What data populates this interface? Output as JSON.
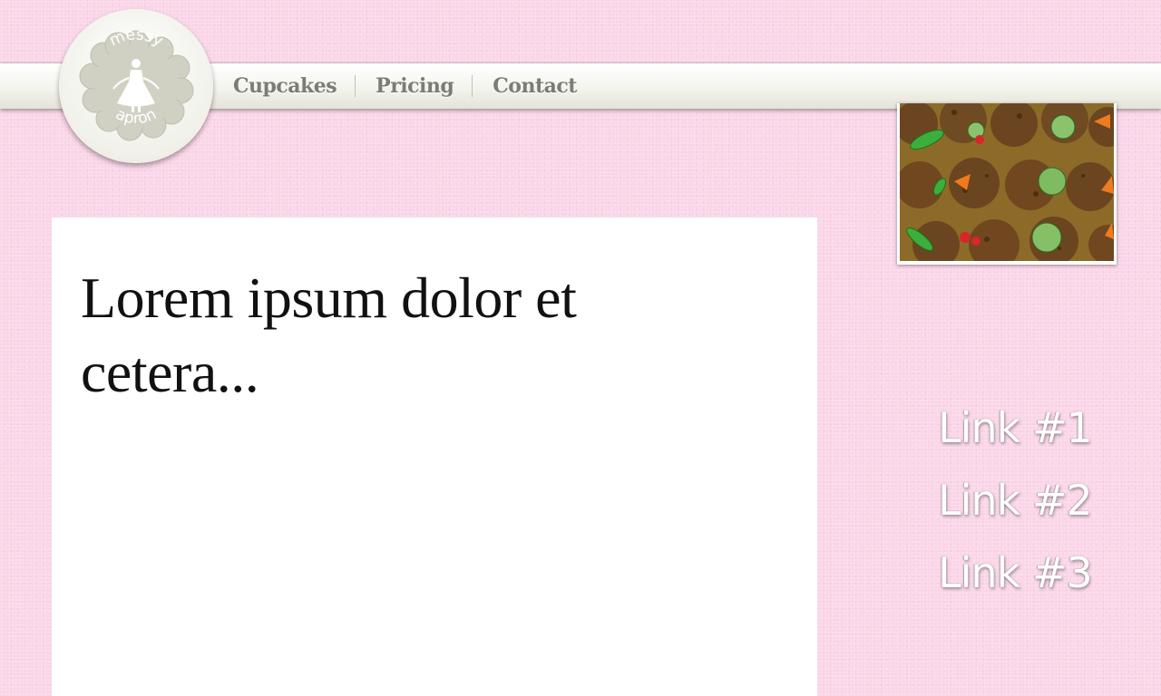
{
  "logo": {
    "text_top": "messy",
    "text_bottom": "apron",
    "icon": "apron-icon",
    "colors": {
      "disc": "#d1d1c3",
      "disc_edge": "#f7f7f1"
    }
  },
  "nav": {
    "items": [
      {
        "label": "Cupcakes"
      },
      {
        "label": "Pricing"
      },
      {
        "label": "Contact"
      }
    ],
    "colors": {
      "text": "#7c7c75",
      "bar": "#f4f4ee"
    }
  },
  "main": {
    "heading": "Lorem ipsum dolor et cetera..."
  },
  "photo": {
    "subject": "cupcakes-photo",
    "description_icon": "cupcake-garden-image"
  },
  "sidebar": {
    "links": [
      {
        "label": "Link #1"
      },
      {
        "label": "Link #2"
      },
      {
        "label": "Link #3"
      }
    ]
  },
  "colors": {
    "page_background": "#fad6e8",
    "panel_background": "#ffffff",
    "heading_text": "#111111",
    "link_text": "#fdfdfd"
  }
}
